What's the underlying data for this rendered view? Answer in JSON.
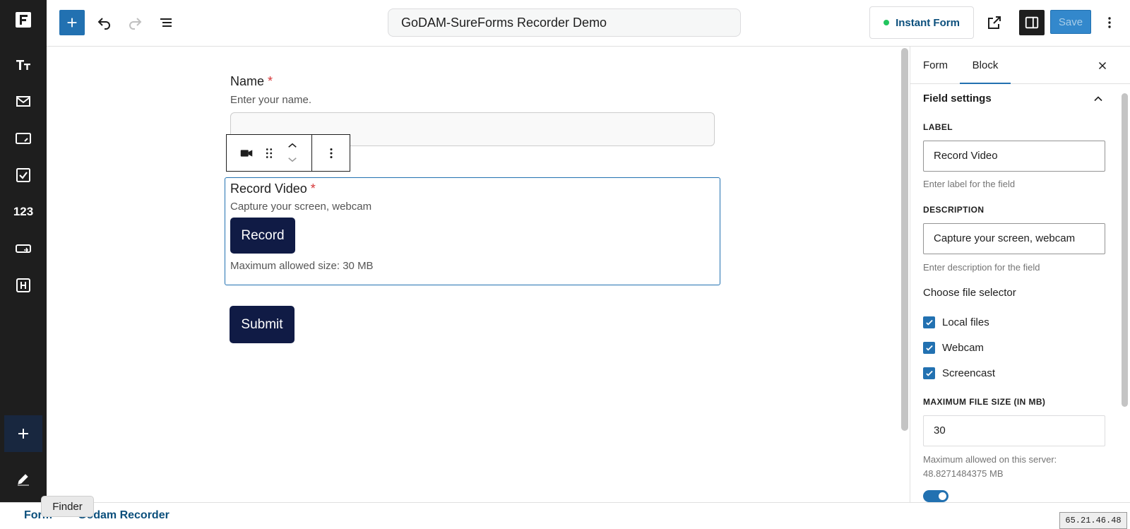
{
  "colors": {
    "sidebar_bg": "#1e1e1e",
    "accent": "#2271b1",
    "button_dark": "#101b45",
    "required": "#d63638",
    "status_green": "#22c55e"
  },
  "sidebar": {
    "icons": [
      "fluentforms-logo-icon",
      "text-icon",
      "email-icon",
      "phone-input-icon",
      "checkbox-icon",
      "number-icon",
      "submit-field-icon",
      "heading-icon",
      "plus-icon",
      "pencil-icon"
    ],
    "number_label": "123"
  },
  "topbar": {
    "doc_title": "GoDAM-SureForms Recorder Demo",
    "instant_form_label": "Instant Form",
    "save_label": "Save"
  },
  "form": {
    "name_field": {
      "label": "Name",
      "required_mark": "*",
      "description": "Enter your name."
    },
    "video_field": {
      "label": "Record Video",
      "required_mark": "*",
      "description": "Capture your screen, webcam",
      "record_label": "Record",
      "max_size_text": "Maximum allowed size: 30 MB"
    },
    "submit_label": "Submit"
  },
  "panel": {
    "tabs": [
      "Form",
      "Block"
    ],
    "active_tab": "Block",
    "section_title": "Field settings",
    "label_caption": "LABEL",
    "label_value": "Record Video",
    "label_help": "Enter label for the field",
    "description_caption": "DESCRIPTION",
    "description_value": "Capture your screen, webcam",
    "description_help": "Enter description for the field",
    "file_selector_title": "Choose file selector",
    "file_selectors": [
      {
        "label": "Local files",
        "checked": true
      },
      {
        "label": "Webcam",
        "checked": true
      },
      {
        "label": "Screencast",
        "checked": true
      }
    ],
    "max_size_caption": "MAXIMUM FILE SIZE (IN MB)",
    "max_size_value": "30",
    "server_limit_line1": "Maximum allowed on this server:",
    "server_limit_line2": "48.8271484375 MB",
    "toggle_on": true
  },
  "footer": {
    "breadcrumbs": [
      "Form",
      "Godam Recorder"
    ],
    "tooltip": "Finder",
    "ip_badge": "65.21.46.48"
  }
}
